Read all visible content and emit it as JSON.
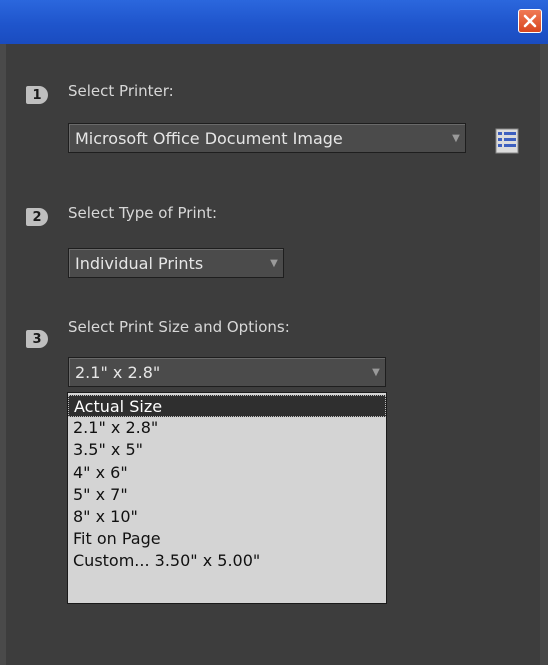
{
  "titlebar": {
    "close_icon": "close-icon"
  },
  "step1": {
    "number": "1",
    "label": "Select Printer:",
    "printer_value": "Microsoft Office Document Image",
    "properties_icon": "printer-properties-icon"
  },
  "step2": {
    "number": "2",
    "label": "Select Type of Print:",
    "type_value": "Individual Prints"
  },
  "step3": {
    "number": "3",
    "label": "Select Print Size and Options:",
    "size_value": "2.1\" x 2.8\""
  },
  "dropdown": {
    "options": [
      "Actual Size",
      "2.1\" x 2.8\"",
      "3.5\" x 5\"",
      "4\" x 6\"",
      "5\" x 7\"",
      "8\" x 10\"",
      "Fit on Page",
      "Custom... 3.50\" x 5.00\""
    ],
    "highlighted_index": 0
  },
  "colors": {
    "titlebar": "#1f55cc",
    "panel": "#3d3d3d",
    "close": "#d8461f"
  }
}
